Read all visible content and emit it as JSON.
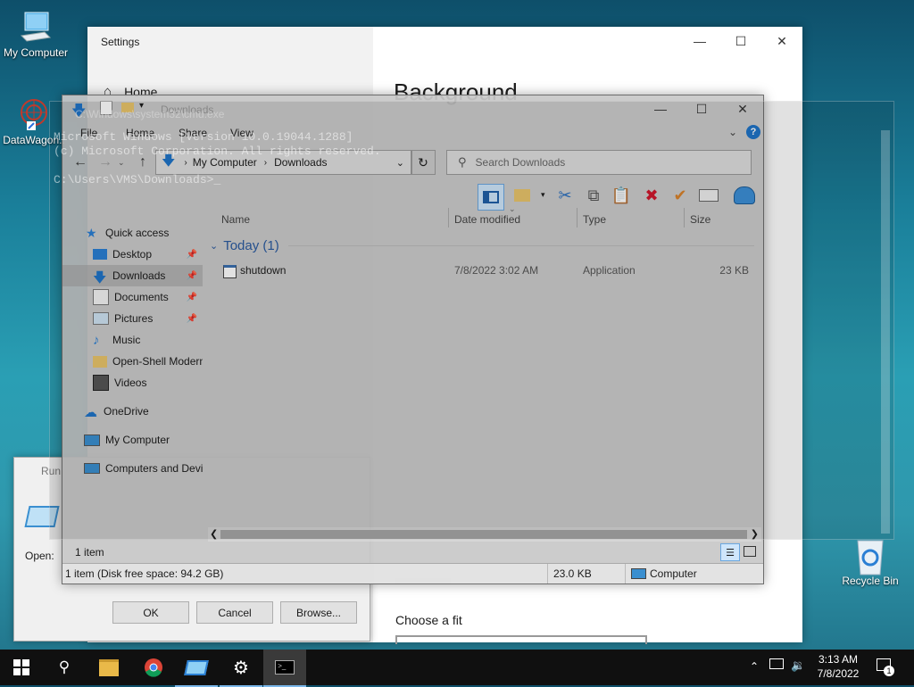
{
  "desktop": {
    "icons": [
      {
        "label": "My Computer"
      },
      {
        "label": "DataWagon.."
      },
      {
        "label": "Recycle Bin"
      }
    ]
  },
  "settings": {
    "title": "Settings",
    "nav_home": "Home",
    "heading": "Background",
    "choose_fit": "Choose a fit"
  },
  "cmd": {
    "title": "C:\\Windows\\system32\\cmd.exe",
    "lines": [
      "Microsoft Windows [Version 10.0.19044.1288]",
      "(c) Microsoft Corporation. All rights reserved.",
      "",
      "C:\\Users\\VMS\\Downloads>"
    ]
  },
  "run": {
    "title": "Run",
    "open_label": "Open:",
    "ok": "OK",
    "cancel": "Cancel",
    "browse": "Browse..."
  },
  "explorer": {
    "title": "Downloads",
    "tabs": [
      "File",
      "Home",
      "Share",
      "View"
    ],
    "breadcrumb": [
      "My Computer",
      "Downloads"
    ],
    "search_placeholder": "Search Downloads",
    "nav": {
      "quick_access": "Quick access",
      "desktop": "Desktop",
      "downloads": "Downloads",
      "documents": "Documents",
      "pictures": "Pictures",
      "music": "Music",
      "openshell": "Open-Shell Modern",
      "videos": "Videos",
      "onedrive": "OneDrive",
      "my_computer": "My Computer",
      "computers_devices": "Computers and Devic"
    },
    "columns": {
      "name": "Name",
      "date": "Date modified",
      "type": "Type",
      "size": "Size"
    },
    "group": "Today (1)",
    "files": [
      {
        "name": "shutdown",
        "date": "7/8/2022 3:02 AM",
        "type": "Application",
        "size": "23 KB"
      }
    ],
    "status_count": "1 item",
    "status_bar": {
      "left": "1 item (Disk free space: 94.2 GB)",
      "size": "23.0 KB",
      "location": "Computer"
    }
  },
  "taskbar": {
    "time": "3:13 AM",
    "date": "7/8/2022",
    "notification_count": "1"
  }
}
